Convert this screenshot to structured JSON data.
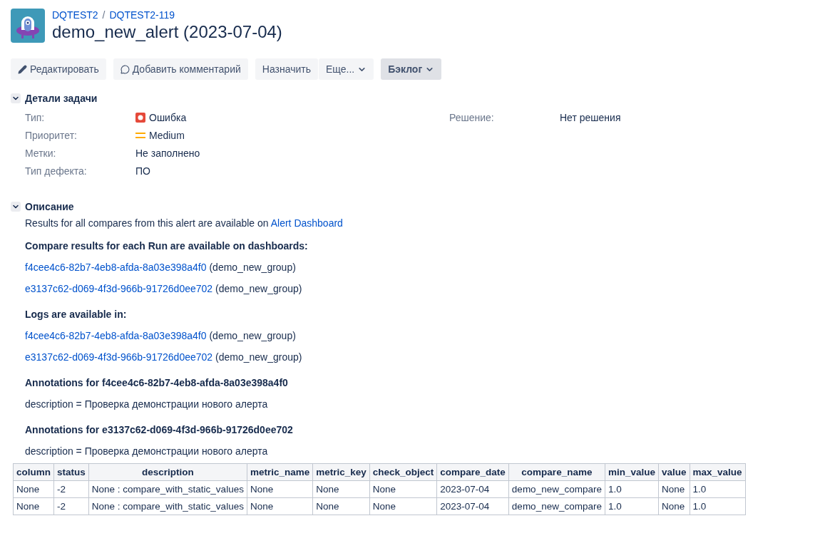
{
  "breadcrumbs": [
    "DQTEST2",
    "DQTEST2-119"
  ],
  "breadcrumb_separator": "/",
  "title": "demo_new_alert (2023-07-04)",
  "toolbar": [
    {
      "label": "Редактировать",
      "kind": "edit"
    },
    {
      "label": "Добавить комментарий",
      "kind": "comment"
    },
    {
      "label": "Назначить",
      "kind": "plain"
    },
    {
      "label": "Еще...",
      "kind": "menu"
    },
    {
      "label": "Бэклог",
      "kind": "status"
    }
  ],
  "details": {
    "title": "Детали задачи",
    "expanded": true,
    "left": [
      {
        "label": "Тип:",
        "value": "Ошибка",
        "kind": "bug"
      },
      {
        "label": "Приоритет:",
        "value": "Medium",
        "kind": "priority"
      },
      {
        "label": "Метки:",
        "value": "Не заполнено"
      },
      {
        "label": "Тип дефекта:",
        "value": "ПО"
      }
    ],
    "right": [
      {
        "label": "Решение:",
        "value": "Нет решения"
      }
    ]
  },
  "description": {
    "title": "Описание",
    "expanded": true,
    "blocks": [
      {
        "kind": "text",
        "text": "Results for all compares from this alert are available on ",
        "link": "Alert Dashboard"
      },
      {
        "kind": "heading",
        "text": "Compare results for each Run are available on dashboards:"
      },
      {
        "kind": "link_line",
        "link": "f4cee4c6-82b7-4eb8-afda-8a03e398a4f0",
        "text": "(demo_new_group)"
      },
      {
        "kind": "link_line",
        "link": "e3137c62-d069-4f3d-966b-91726d0ee702",
        "text": "(demo_new_group)"
      },
      {
        "kind": "heading",
        "text": "Logs are available in:"
      },
      {
        "kind": "link_line",
        "link": "f4cee4c6-82b7-4eb8-afda-8a03e398a4f0",
        "text": "(demo_new_group)"
      },
      {
        "kind": "link_line",
        "link": "e3137c62-d069-4f3d-966b-91726d0ee702",
        "text": "(demo_new_group)"
      },
      {
        "kind": "heading",
        "text": "Annotations for f4cee4c6-82b7-4eb8-afda-8a03e398a4f0"
      },
      {
        "kind": "plain",
        "text": "description = Проверка демонстрации нового алерта"
      },
      {
        "kind": "heading",
        "text": "Annotations for e3137c62-d069-4f3d-966b-91726d0ee702"
      },
      {
        "kind": "plain",
        "text": "description = Проверка демонстрации нового алерта"
      }
    ],
    "table": {
      "columns": [
        "column",
        "status",
        "description",
        "metric_name",
        "metric_key",
        "check_object",
        "compare_date",
        "compare_name",
        "min_value",
        "value",
        "max_value"
      ],
      "rows": [
        [
          "None",
          "-2",
          "None : compare_with_static_values",
          "None",
          "None",
          "None",
          "2023-07-04",
          "demo_new_compare",
          "1.0",
          "None",
          "1.0"
        ],
        [
          "None",
          "-2",
          "None : compare_with_static_values",
          "None",
          "None",
          "None",
          "2023-07-04",
          "demo_new_compare",
          "1.0",
          "None",
          "1.0"
        ]
      ]
    }
  }
}
